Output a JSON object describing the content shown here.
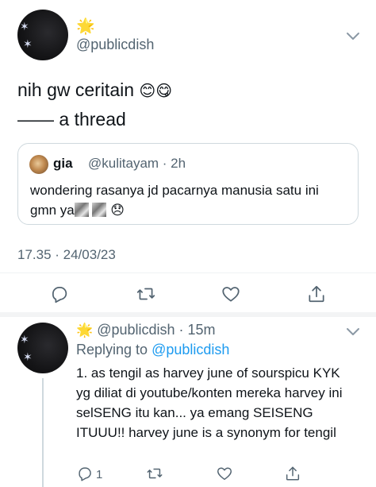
{
  "main_tweet": {
    "author_badge_emoji": "🌟",
    "handle": "@publicdish",
    "text_line1": "nih gw ceritain",
    "text_emojis": "😊😋",
    "text_line2": "—— a thread",
    "timestamp": "17.35 · 24/03/23",
    "more_icon": "chevron-down-icon"
  },
  "quoted_tweet": {
    "name": "gia",
    "handle_time": "@kulitayam · 2h",
    "text_line1": "wondering rasanya jd pacarnya manusia satu ini",
    "text_line2": "gmn ya",
    "sad_emoji": "😞"
  },
  "actions": {
    "reply_icon": "reply-icon",
    "retweet_icon": "retweet-icon",
    "like_icon": "heart-icon",
    "share_icon": "share-icon"
  },
  "reply_tweet": {
    "author_badge_emoji": "🌟",
    "handle_time": "@publicdish · 15m",
    "replying_to_label": "Replying to",
    "replying_to_handle": "@publicdish",
    "text": "1. as tengil as harvey june of sourspicu KYK yg diliat di youtube/konten mereka harvey ini selSENG itu kan... ya emang SEISENG ITUUU!! harvey june is a synonym for tengil",
    "reply_count": "1"
  },
  "colors": {
    "text": "#0f1419",
    "secondary": "#536471",
    "link": "#1d9bf0",
    "border": "#cfd9de"
  }
}
